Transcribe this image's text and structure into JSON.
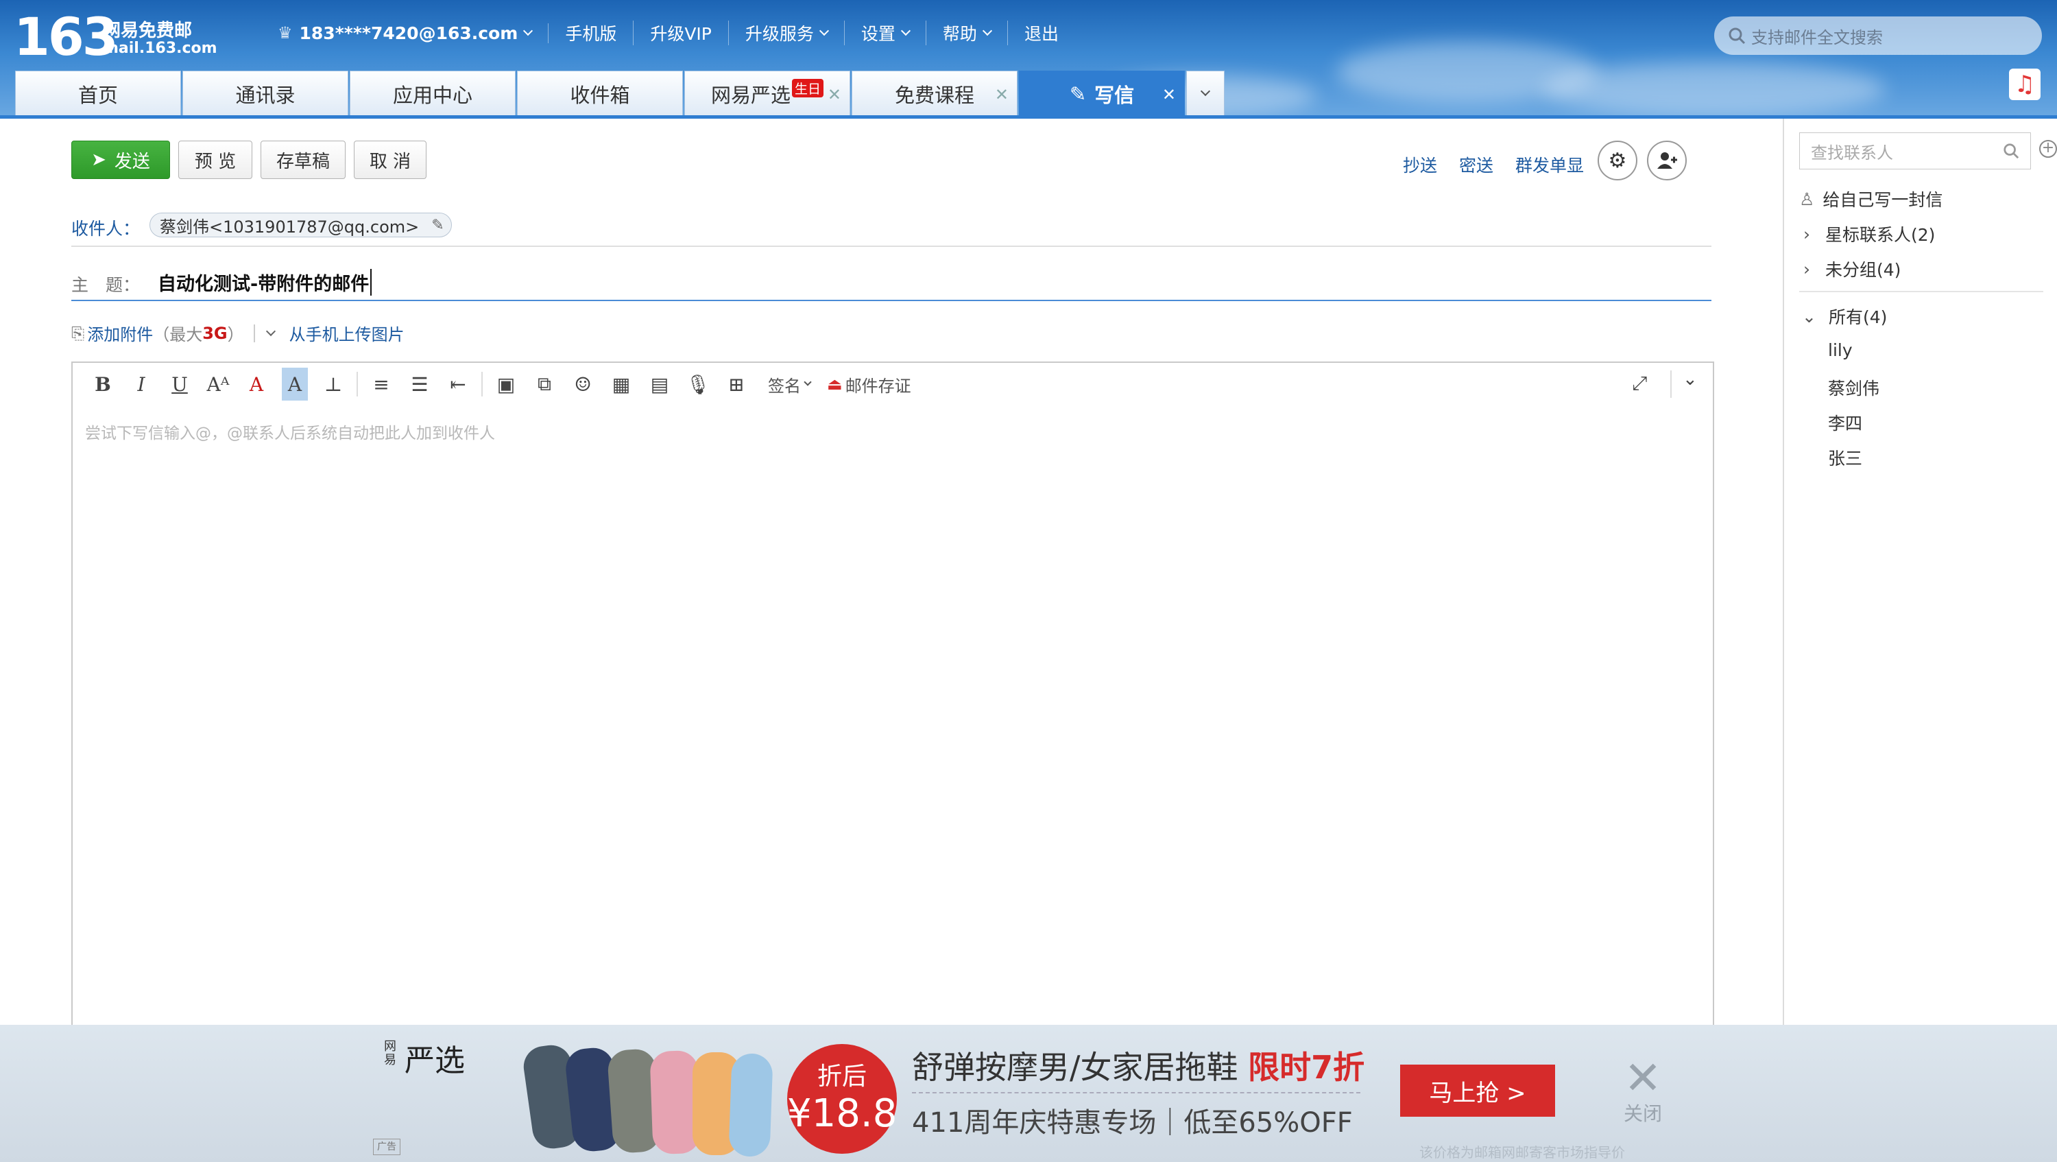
{
  "header": {
    "logo_number": "163",
    "logo_name": "网易免费邮",
    "logo_domain": "mail.163.com",
    "account": "183****7420@163.com",
    "nav": [
      "手机版",
      "升级VIP",
      "升级服务",
      "设置",
      "帮助",
      "退出"
    ],
    "search_placeholder": "支持邮件全文搜索"
  },
  "tabs": [
    {
      "label": "首页"
    },
    {
      "label": "通讯录"
    },
    {
      "label": "应用中心"
    },
    {
      "label": "收件箱"
    },
    {
      "label": "网易严选",
      "badge": "生日"
    },
    {
      "label": "免费课程"
    },
    {
      "label": "写信"
    }
  ],
  "compose": {
    "send": "发送",
    "preview": "预 览",
    "save_draft": "存草稿",
    "cancel": "取 消",
    "cc": "抄送",
    "bcc": "密送",
    "separate_send": "群发单显",
    "to_label": "收件人：",
    "recipient": "蔡剑伟<1031901787@qq.com>",
    "subject_label": "主　题：",
    "subject_value": "自动化测试-带附件的邮件",
    "attach": "添加附件",
    "attach_hint_prefix": "（最大",
    "attach_max": "3G",
    "attach_hint_suffix": "）",
    "mobile_upload": "从手机上传图片",
    "toolbar_signature": "签名",
    "toolbar_certify": "邮件存证",
    "body_placeholder": "尝试下写信输入@，@联系人后系统自动把此人加到收件人"
  },
  "sidebar": {
    "search_placeholder": "查找联系人",
    "write_self": "给自己写一封信",
    "starred": "星标联系人(2)",
    "ungrouped": "未分组(4)",
    "all": "所有(4)",
    "contacts": [
      "lily",
      "蔡剑伟",
      "李四",
      "张三"
    ]
  },
  "ad": {
    "brand_small": "网易",
    "brand": "严选",
    "price_label": "折后",
    "price": "¥18.8",
    "headline": "舒弹按摩男/女家居拖鞋",
    "headline_red": "限时7折",
    "subline": "411周年庆特惠专场｜低至65%OFF",
    "cta": "马上抢 >",
    "close": "关闭",
    "note": "该价格为邮箱网邮寄客市场指导价",
    "tag": "广告"
  },
  "colors": {
    "accent": "#2f7dd1",
    "send_green": "#38a534",
    "ad_red": "#d62b2b",
    "link": "#1d5aa0"
  }
}
